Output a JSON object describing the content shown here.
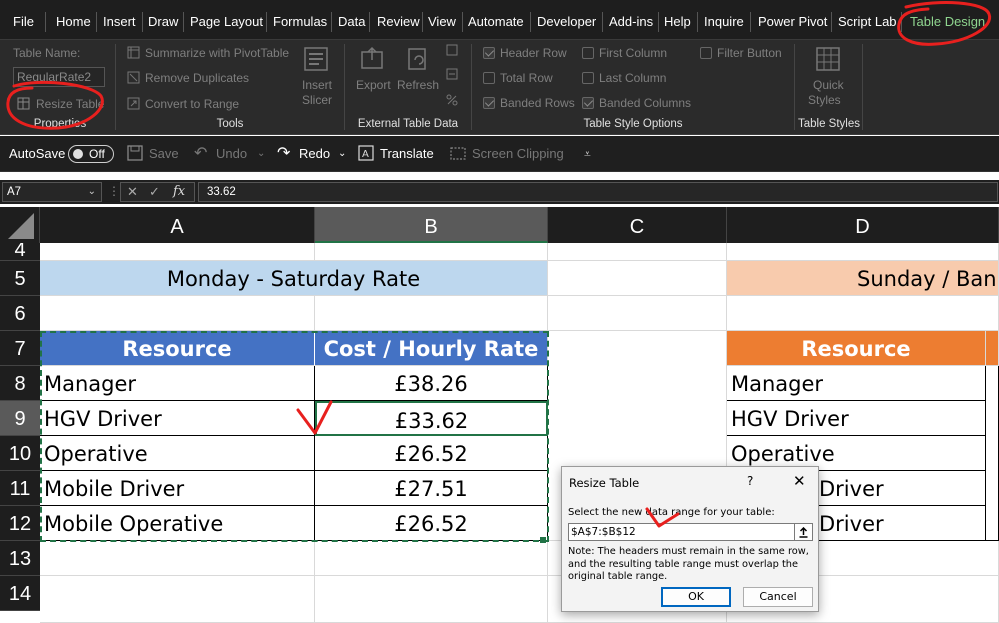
{
  "menu": {
    "tabs": [
      "File",
      "Home",
      "Insert",
      "Draw",
      "Page Layout",
      "Formulas",
      "Data",
      "Review",
      "View",
      "Automate",
      "Developer",
      "Add-ins",
      "Help",
      "Inquire",
      "Power Pivot",
      "Script Lab",
      "Table Design"
    ],
    "active_tab": "Table Design"
  },
  "ribbon": {
    "properties": {
      "table_name_label": "Table Name:",
      "table_name_value": "RegularRate2",
      "resize_label": "Resize Table",
      "group_label": "Properties"
    },
    "tools": {
      "summarize": "Summarize with PivotTable",
      "remove_duplicates": "Remove Duplicates",
      "convert_to_range": "Convert to Range",
      "insert_slicer_line1": "Insert",
      "insert_slicer_line2": "Slicer",
      "group_label": "Tools"
    },
    "external": {
      "export_label": "Export",
      "refresh_label": "Refresh",
      "group_label": "External Table Data"
    },
    "style_options": {
      "header_row": "Header Row",
      "total_row": "Total Row",
      "banded_rows": "Banded Rows",
      "first_column": "First Column",
      "last_column": "Last Column",
      "banded_columns": "Banded Columns",
      "filter_button": "Filter Button",
      "group_label": "Table Style Options"
    },
    "styles": {
      "quick_styles_line1": "Quick",
      "quick_styles_line2": "Styles",
      "group_label": "Table Styles"
    }
  },
  "quick_access": {
    "autosave_label": "AutoSave",
    "autosave_state": "Off",
    "save": "Save",
    "undo": "Undo",
    "redo": "Redo",
    "translate": "Translate",
    "screen_clipping": "Screen Clipping"
  },
  "formula_bar": {
    "name_box": "A7",
    "fx": "fx",
    "formula": "33.62"
  },
  "grid": {
    "columns": [
      "A",
      "B",
      "C",
      "D"
    ],
    "rows": [
      "4",
      "5",
      "6",
      "7",
      "8",
      "9",
      "10",
      "11",
      "12",
      "13",
      "14"
    ],
    "left_title": "Monday - Saturday Rate",
    "right_title": "Sunday / Bank",
    "left_table": {
      "headers": [
        "Resource",
        "Cost / Hourly Rate"
      ],
      "rows": [
        [
          "Manager",
          "£38.26"
        ],
        [
          "HGV Driver",
          "£33.62"
        ],
        [
          "Operative",
          "£26.52"
        ],
        [
          "Mobile Driver",
          "£27.51"
        ],
        [
          "Mobile Operative",
          "£26.52"
        ]
      ]
    },
    "right_table": {
      "header": "Resource",
      "rows": [
        "Manager",
        "HGV Driver",
        "Operative",
        "Driver",
        "Driver"
      ]
    }
  },
  "dialog": {
    "title": "Resize Table",
    "help": "?",
    "close": "✕",
    "prompt": "Select the new data range for your table:",
    "range": "$A$7:$B$12",
    "note": "Note: The headers must remain in the same row, and the resulting table range must overlap the original table range.",
    "ok": "OK",
    "cancel": "Cancel"
  },
  "colors": {
    "left_title_bg": "#bdd7ee",
    "left_header_bg": "#4472c4",
    "right_title_bg": "#f8cbad",
    "right_header_bg": "#ed7d31",
    "annotation": "#e8201e",
    "active_tab": "#8fd58f"
  }
}
